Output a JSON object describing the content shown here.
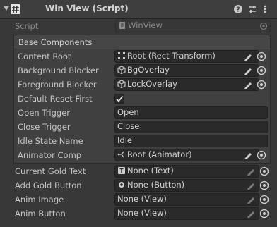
{
  "header": {
    "title": "Win View (Script)",
    "icons": [
      "hash-script-icon",
      "help-icon",
      "presets-sliders-icon",
      "more-vertical-icon"
    ]
  },
  "script_row": {
    "label": "Script",
    "value": "WinView"
  },
  "group": {
    "title": "Base Components",
    "rows": [
      {
        "label": "Content Root",
        "value": "Root (Rect Transform)",
        "icon": "rect-transform-icon",
        "pencil": true,
        "picker": true
      },
      {
        "label": "Background Blocker",
        "value": "BgOverlay",
        "icon": "gameobject-cube-icon",
        "pencil": true,
        "picker": true
      },
      {
        "label": "Foreground Blocker",
        "value": "LockOverlay",
        "icon": "gameobject-cube-icon",
        "pencil": true,
        "picker": true
      },
      {
        "label": "Default Reset First",
        "checked": true
      },
      {
        "label": "Open Trigger",
        "value": "Open"
      },
      {
        "label": "Close Trigger",
        "value": "Close"
      },
      {
        "label": "Idle State Name",
        "value": "Idle"
      },
      {
        "label": "Animator Comp",
        "value": "Root (Animator)",
        "icon": "animator-icon",
        "pencil": true,
        "picker": true
      }
    ]
  },
  "fields": [
    {
      "label": "Current Gold Text",
      "value": "None (Text)",
      "icon": "text-component-icon"
    },
    {
      "label": "Add Gold Button",
      "value": "None (Button)",
      "icon": "button-component-icon"
    },
    {
      "label": "Anim Image",
      "value": "None (View)"
    },
    {
      "label": "Anim Button",
      "value": "None (View)"
    }
  ]
}
